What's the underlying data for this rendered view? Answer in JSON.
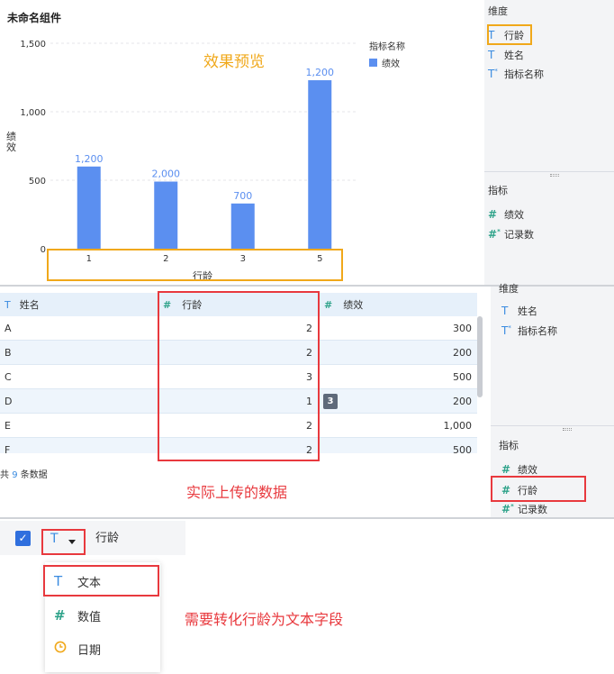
{
  "chart": {
    "widget_title": "未命名组件",
    "overlay_label": "效果预览",
    "legend_title": "指标名称",
    "legend_entry": "绩效",
    "ylabel": "绩效",
    "xlabel": "行龄",
    "bar_color": "#5b8ff0"
  },
  "chart_data": {
    "type": "bar",
    "categories": [
      "1",
      "2",
      "3",
      "5"
    ],
    "values": [
      600,
      490,
      330,
      1230
    ],
    "data_labels": [
      "1,200",
      "2,000",
      "700",
      "1,200"
    ],
    "yticks": [
      "1,500",
      "1,000",
      "500",
      "0"
    ],
    "ylim": [
      0,
      1500
    ],
    "ytick_values": [
      1500,
      1000,
      500,
      0
    ],
    "grid": true,
    "legend": "top-right",
    "series": [
      {
        "name": "绩效",
        "values": [
          600,
          490,
          330,
          1230
        ]
      }
    ]
  },
  "panel1": {
    "dimension_title": "维度",
    "dimensions": [
      {
        "icon": "T",
        "label": "行龄"
      },
      {
        "icon": "T",
        "label": "姓名"
      },
      {
        "icon": "T*",
        "label": "指标名称"
      }
    ],
    "metric_title": "指标",
    "metrics": [
      {
        "icon": "#",
        "label": "绩效"
      },
      {
        "icon": "#*",
        "label": "记录数"
      }
    ]
  },
  "table": {
    "headers": [
      {
        "icon": "T",
        "label": "姓名"
      },
      {
        "icon": "#",
        "label": "行龄"
      },
      {
        "icon": "#",
        "label": "绩效"
      }
    ],
    "rows": [
      {
        "name": "A",
        "age": "2",
        "perf": "300"
      },
      {
        "name": "B",
        "age": "2",
        "perf": "200"
      },
      {
        "name": "C",
        "age": "3",
        "perf": "500"
      },
      {
        "name": "D",
        "age": "1",
        "perf": "200"
      },
      {
        "name": "E",
        "age": "2",
        "perf": "1,000"
      },
      {
        "name": "F",
        "age": "2",
        "perf": "500"
      }
    ],
    "badge": "3",
    "footer_prefix": "共",
    "footer_count": "9",
    "footer_suffix": "条数据",
    "annotation": "实际上传的数据"
  },
  "panel2": {
    "dimension_title": "维度",
    "dimensions": [
      {
        "icon": "T",
        "label": "姓名"
      },
      {
        "icon": "T*",
        "label": "指标名称"
      }
    ],
    "metric_title": "指标",
    "metrics": [
      {
        "icon": "#",
        "label": "绩效"
      },
      {
        "icon": "#",
        "label": "行龄"
      },
      {
        "icon": "#*",
        "label": "记录数"
      }
    ]
  },
  "field_type": {
    "field_name": "行龄",
    "type_icon": "T",
    "options": [
      {
        "icon": "T",
        "label": "文本"
      },
      {
        "icon": "#",
        "label": "数值"
      },
      {
        "icon": "clock",
        "label": "日期"
      }
    ],
    "annotation": "需要转化行龄为文本字段"
  },
  "colors": {
    "accent_blue": "#3a8be0",
    "orange_highlight": "#f0a81a",
    "red_highlight": "#e8393e",
    "green_icon": "#2fa38a"
  }
}
